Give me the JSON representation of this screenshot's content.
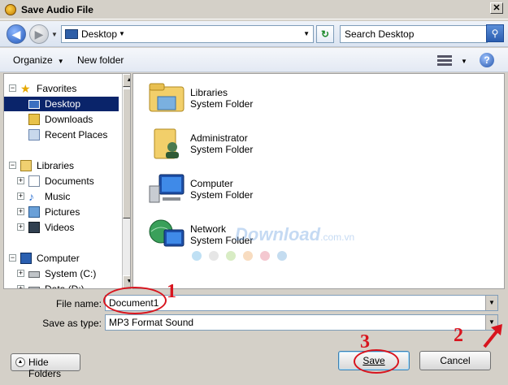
{
  "window": {
    "title": "Save Audio File",
    "close_label": "✕"
  },
  "nav": {
    "back_icon": "◀",
    "forward_icon": "▶",
    "address": "Desktop",
    "search_placeholder": "Search Desktop"
  },
  "toolbar": {
    "organize_label": "Organize",
    "new_folder_label": "New folder",
    "help_label": "?"
  },
  "sidebar": {
    "items": [
      {
        "label": "Favorites",
        "expander": "−",
        "icon": "star-icon"
      },
      {
        "label": "Desktop",
        "selected": true,
        "icon": "desktop-icon"
      },
      {
        "label": "Downloads",
        "icon": "downloads-icon"
      },
      {
        "label": "Recent Places",
        "icon": "recent-places-icon"
      },
      {
        "label": "Libraries",
        "expander": "−",
        "icon": "libraries-icon"
      },
      {
        "label": "Documents",
        "expander": "+",
        "icon": "documents-icon"
      },
      {
        "label": "Music",
        "expander": "+",
        "icon": "music-icon"
      },
      {
        "label": "Pictures",
        "expander": "+",
        "icon": "pictures-icon"
      },
      {
        "label": "Videos",
        "expander": "+",
        "icon": "videos-icon"
      },
      {
        "label": "Computer",
        "expander": "−",
        "icon": "computer-icon"
      },
      {
        "label": "System (C:)",
        "expander": "+",
        "icon": "drive-icon"
      },
      {
        "label": "Data (D:)",
        "expander": "+",
        "icon": "drive-icon"
      }
    ]
  },
  "files": [
    {
      "name": "Libraries",
      "type": "System Folder",
      "icon": "libraries-folder-icon"
    },
    {
      "name": "Administrator",
      "type": "System Folder",
      "icon": "user-folder-icon"
    },
    {
      "name": "Computer",
      "type": "System Folder",
      "icon": "computer-icon"
    },
    {
      "name": "Network",
      "type": "System Folder",
      "icon": "network-icon"
    }
  ],
  "watermark": {
    "text": "Download",
    "suffix": ".com.vn"
  },
  "form": {
    "file_name_label": "File name:",
    "file_name_value": "Document1",
    "save_type_label": "Save as type:",
    "save_type_value": "MP3 Format Sound"
  },
  "buttons": {
    "hide_folders": "Hide Folders",
    "save": "Save",
    "cancel": "Cancel"
  },
  "annotations": {
    "step1": "1",
    "step2": "2",
    "step3": "3",
    "color": "#d8141e"
  }
}
